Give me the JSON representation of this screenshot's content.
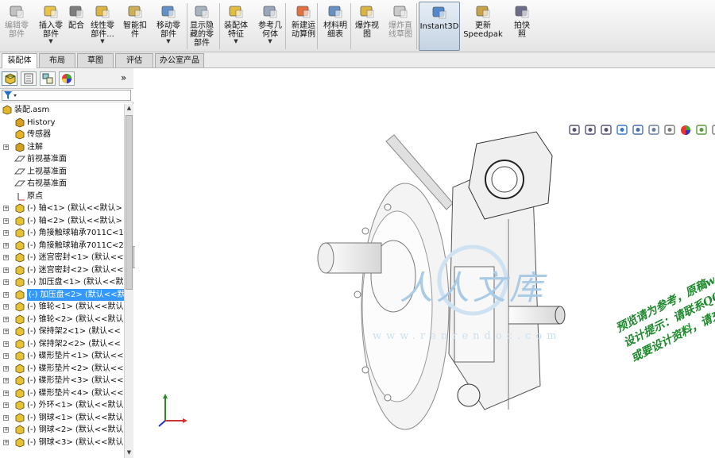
{
  "ribbon": {
    "buttons": [
      {
        "name": "edit-component-button",
        "label": "编辑零\n部件",
        "disabled": true,
        "dropdown": false,
        "icon": "edit-component-icon"
      },
      {
        "name": "insert-component-button",
        "label": "插入零\n部件",
        "disabled": false,
        "dropdown": true,
        "icon": "insert-component-icon"
      },
      {
        "name": "mate-button",
        "label": "配合",
        "disabled": false,
        "dropdown": false,
        "icon": "paperclip-icon"
      },
      {
        "name": "linear-pattern-button",
        "label": "线性零\n部件...",
        "disabled": false,
        "dropdown": true,
        "icon": "linear-pattern-icon"
      },
      {
        "name": "smart-fasteners-button",
        "label": "智能扣\n件",
        "disabled": false,
        "dropdown": false,
        "icon": "smart-fastener-icon"
      },
      {
        "name": "move-component-button",
        "label": "移动零\n部件",
        "disabled": false,
        "dropdown": true,
        "icon": "move-component-icon"
      },
      {
        "name": "show-hidden-button",
        "label": "显示隐\n藏的零\n部件",
        "disabled": false,
        "dropdown": false,
        "icon": "show-hidden-icon"
      },
      {
        "name": "assembly-features-button",
        "label": "装配体\n特征",
        "disabled": false,
        "dropdown": true,
        "icon": "assembly-feature-icon"
      },
      {
        "name": "reference-geometry-button",
        "label": "参考几\n何体",
        "disabled": false,
        "dropdown": true,
        "icon": "reference-geometry-icon"
      },
      {
        "name": "new-motion-study-button",
        "label": "新建运\n动算例",
        "disabled": false,
        "dropdown": false,
        "icon": "motion-study-icon"
      },
      {
        "name": "bom-button",
        "label": "材料明\n细表",
        "disabled": false,
        "dropdown": false,
        "icon": "bom-icon"
      },
      {
        "name": "exploded-view-button",
        "label": "爆炸视\n图",
        "disabled": false,
        "dropdown": false,
        "icon": "exploded-view-icon"
      },
      {
        "name": "explode-line-sketch-button",
        "label": "爆炸直\n线草图",
        "disabled": true,
        "dropdown": false,
        "icon": "explode-line-icon"
      },
      {
        "name": "instant3d-button",
        "label": "Instant3D",
        "disabled": false,
        "dropdown": false,
        "active": true,
        "icon": "instant3d-icon"
      },
      {
        "name": "update-speedpak-button",
        "label": "更新\nSpeedpak",
        "disabled": false,
        "dropdown": false,
        "icon": "speedpak-icon"
      },
      {
        "name": "take-snapshot-button",
        "label": "拍快照",
        "disabled": false,
        "dropdown": false,
        "icon": "snapshot-icon"
      }
    ]
  },
  "tabs": [
    {
      "label": "装配体",
      "active": true
    },
    {
      "label": "布局",
      "active": false
    },
    {
      "label": "草图",
      "active": false
    },
    {
      "label": "评估",
      "active": false
    },
    {
      "label": "办公室产品",
      "active": false
    }
  ],
  "panel": {
    "tabs": [
      "feature-manager-icon",
      "property-manager-icon",
      "configuration-manager-icon",
      "display-manager-icon"
    ],
    "more": "»",
    "filter_icon": "filter-icon"
  },
  "tree": [
    {
      "label": "装配.asm",
      "icon": "assembly-icon",
      "expand": "",
      "indent": 0,
      "selected": false
    },
    {
      "label": "History",
      "icon": "history-icon",
      "expand": "",
      "indent": 1,
      "selected": false
    },
    {
      "label": "传感器",
      "icon": "sensor-icon",
      "expand": "",
      "indent": 1,
      "selected": false
    },
    {
      "label": "注解",
      "icon": "annotation-icon",
      "expand": "+",
      "indent": 1,
      "selected": false
    },
    {
      "label": "前视基准面",
      "icon": "plane-icon",
      "expand": "",
      "indent": 1,
      "selected": false
    },
    {
      "label": "上视基准面",
      "icon": "plane-icon",
      "expand": "",
      "indent": 1,
      "selected": false
    },
    {
      "label": "右视基准面",
      "icon": "plane-icon",
      "expand": "",
      "indent": 1,
      "selected": false
    },
    {
      "label": "原点",
      "icon": "origin-icon",
      "expand": "",
      "indent": 1,
      "selected": false
    },
    {
      "label": "(-) 轴<1> (默认<<默认>",
      "icon": "part-icon",
      "expand": "+",
      "indent": 1,
      "selected": false
    },
    {
      "label": "(-) 轴<2> (默认<<默认>",
      "icon": "part-icon",
      "expand": "+",
      "indent": 1,
      "selected": false
    },
    {
      "label": "(-) 角接触球轴承7011C<1",
      "icon": "part-icon",
      "expand": "+",
      "indent": 1,
      "selected": false
    },
    {
      "label": "(-) 角接触球轴承7011C<2",
      "icon": "part-icon",
      "expand": "+",
      "indent": 1,
      "selected": false
    },
    {
      "label": "(-) 迷宫密封<1> (默认<<",
      "icon": "part-icon",
      "expand": "+",
      "indent": 1,
      "selected": false
    },
    {
      "label": "(-) 迷宫密封<2> (默认<<",
      "icon": "part-icon",
      "expand": "+",
      "indent": 1,
      "selected": false
    },
    {
      "label": "(-) 加压盘<1> (默认<<默",
      "icon": "part-icon",
      "expand": "+",
      "indent": 1,
      "selected": false
    },
    {
      "label": "(-) 加压盘<2> (默认<<默",
      "icon": "part-icon",
      "expand": "+",
      "indent": 1,
      "selected": true
    },
    {
      "label": "(-) 锥轮<1> (默认<<默认",
      "icon": "part-icon",
      "expand": "+",
      "indent": 1,
      "selected": false
    },
    {
      "label": "(-) 锥轮<2> (默认<<默认",
      "icon": "part-icon",
      "expand": "+",
      "indent": 1,
      "selected": false
    },
    {
      "label": "(-) 保持架2<1> (默认<<",
      "icon": "part-icon",
      "expand": "+",
      "indent": 1,
      "selected": false
    },
    {
      "label": "(-) 保持架2<2> (默认<<",
      "icon": "part-icon",
      "expand": "+",
      "indent": 1,
      "selected": false
    },
    {
      "label": "(-) 碟形垫片<1> (默认<<",
      "icon": "part-icon",
      "expand": "+",
      "indent": 1,
      "selected": false
    },
    {
      "label": "(-) 碟形垫片<2> (默认<<",
      "icon": "part-icon",
      "expand": "+",
      "indent": 1,
      "selected": false
    },
    {
      "label": "(-) 碟形垫片<3> (默认<<",
      "icon": "part-icon",
      "expand": "+",
      "indent": 1,
      "selected": false
    },
    {
      "label": "(-) 碟形垫片<4> (默认<<",
      "icon": "part-icon",
      "expand": "+",
      "indent": 1,
      "selected": false
    },
    {
      "label": "(-) 外环<1> (默认<<默认",
      "icon": "part-icon",
      "expand": "+",
      "indent": 1,
      "selected": false
    },
    {
      "label": "(-) 钢球<1> (默认<<默认",
      "icon": "part-icon",
      "expand": "+",
      "indent": 1,
      "selected": false
    },
    {
      "label": "(-) 钢球<2> (默认<<默认",
      "icon": "part-icon",
      "expand": "+",
      "indent": 1,
      "selected": false
    },
    {
      "label": "(-) 钢球<3> (默认<<默认",
      "icon": "part-icon",
      "expand": "+",
      "indent": 1,
      "selected": false
    }
  ],
  "viewport": {
    "toolbar": [
      "zoom-to-fit-icon",
      "zoom-area-icon",
      "previous-view-icon",
      "section-view-icon",
      "view-orientation-icon",
      "display-style-icon",
      "hide-show-icon",
      "edit-appearance-icon",
      "apply-scene-icon",
      "view-settings-icon"
    ],
    "watermark_logo": "人人文库",
    "watermark_site": "www.renrendoc.com",
    "notice_lines": [
      "预览请为参考，原稿word+CAD全套资料！",
      "设计提示：请联系QQ:1459919609",
      "或要设计资料，请充值下载购买正版！"
    ],
    "notice_color": "#1f8a2e"
  }
}
